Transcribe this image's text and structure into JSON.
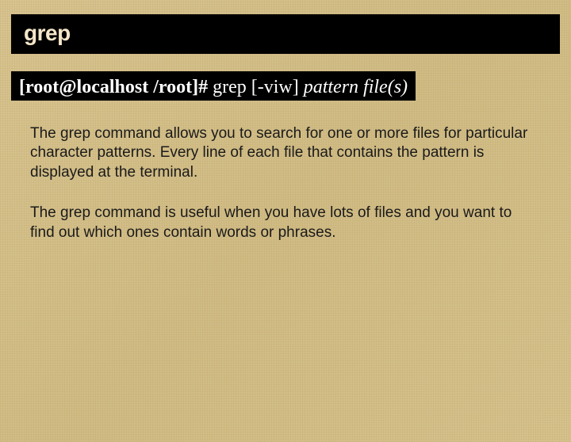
{
  "title": "grep",
  "command": {
    "prompt": "[root@localhost /root]#",
    "cmd": "grep",
    "flags": "[-viw]",
    "args": "pattern file(s)"
  },
  "paragraphs": {
    "p1": "The grep command allows you to search for one or more files for particular character patterns. Every line of each file that contains the pattern is displayed at the terminal.",
    "p2": "The grep command is useful when you have lots of files and you want to find out which ones contain words or phrases."
  }
}
